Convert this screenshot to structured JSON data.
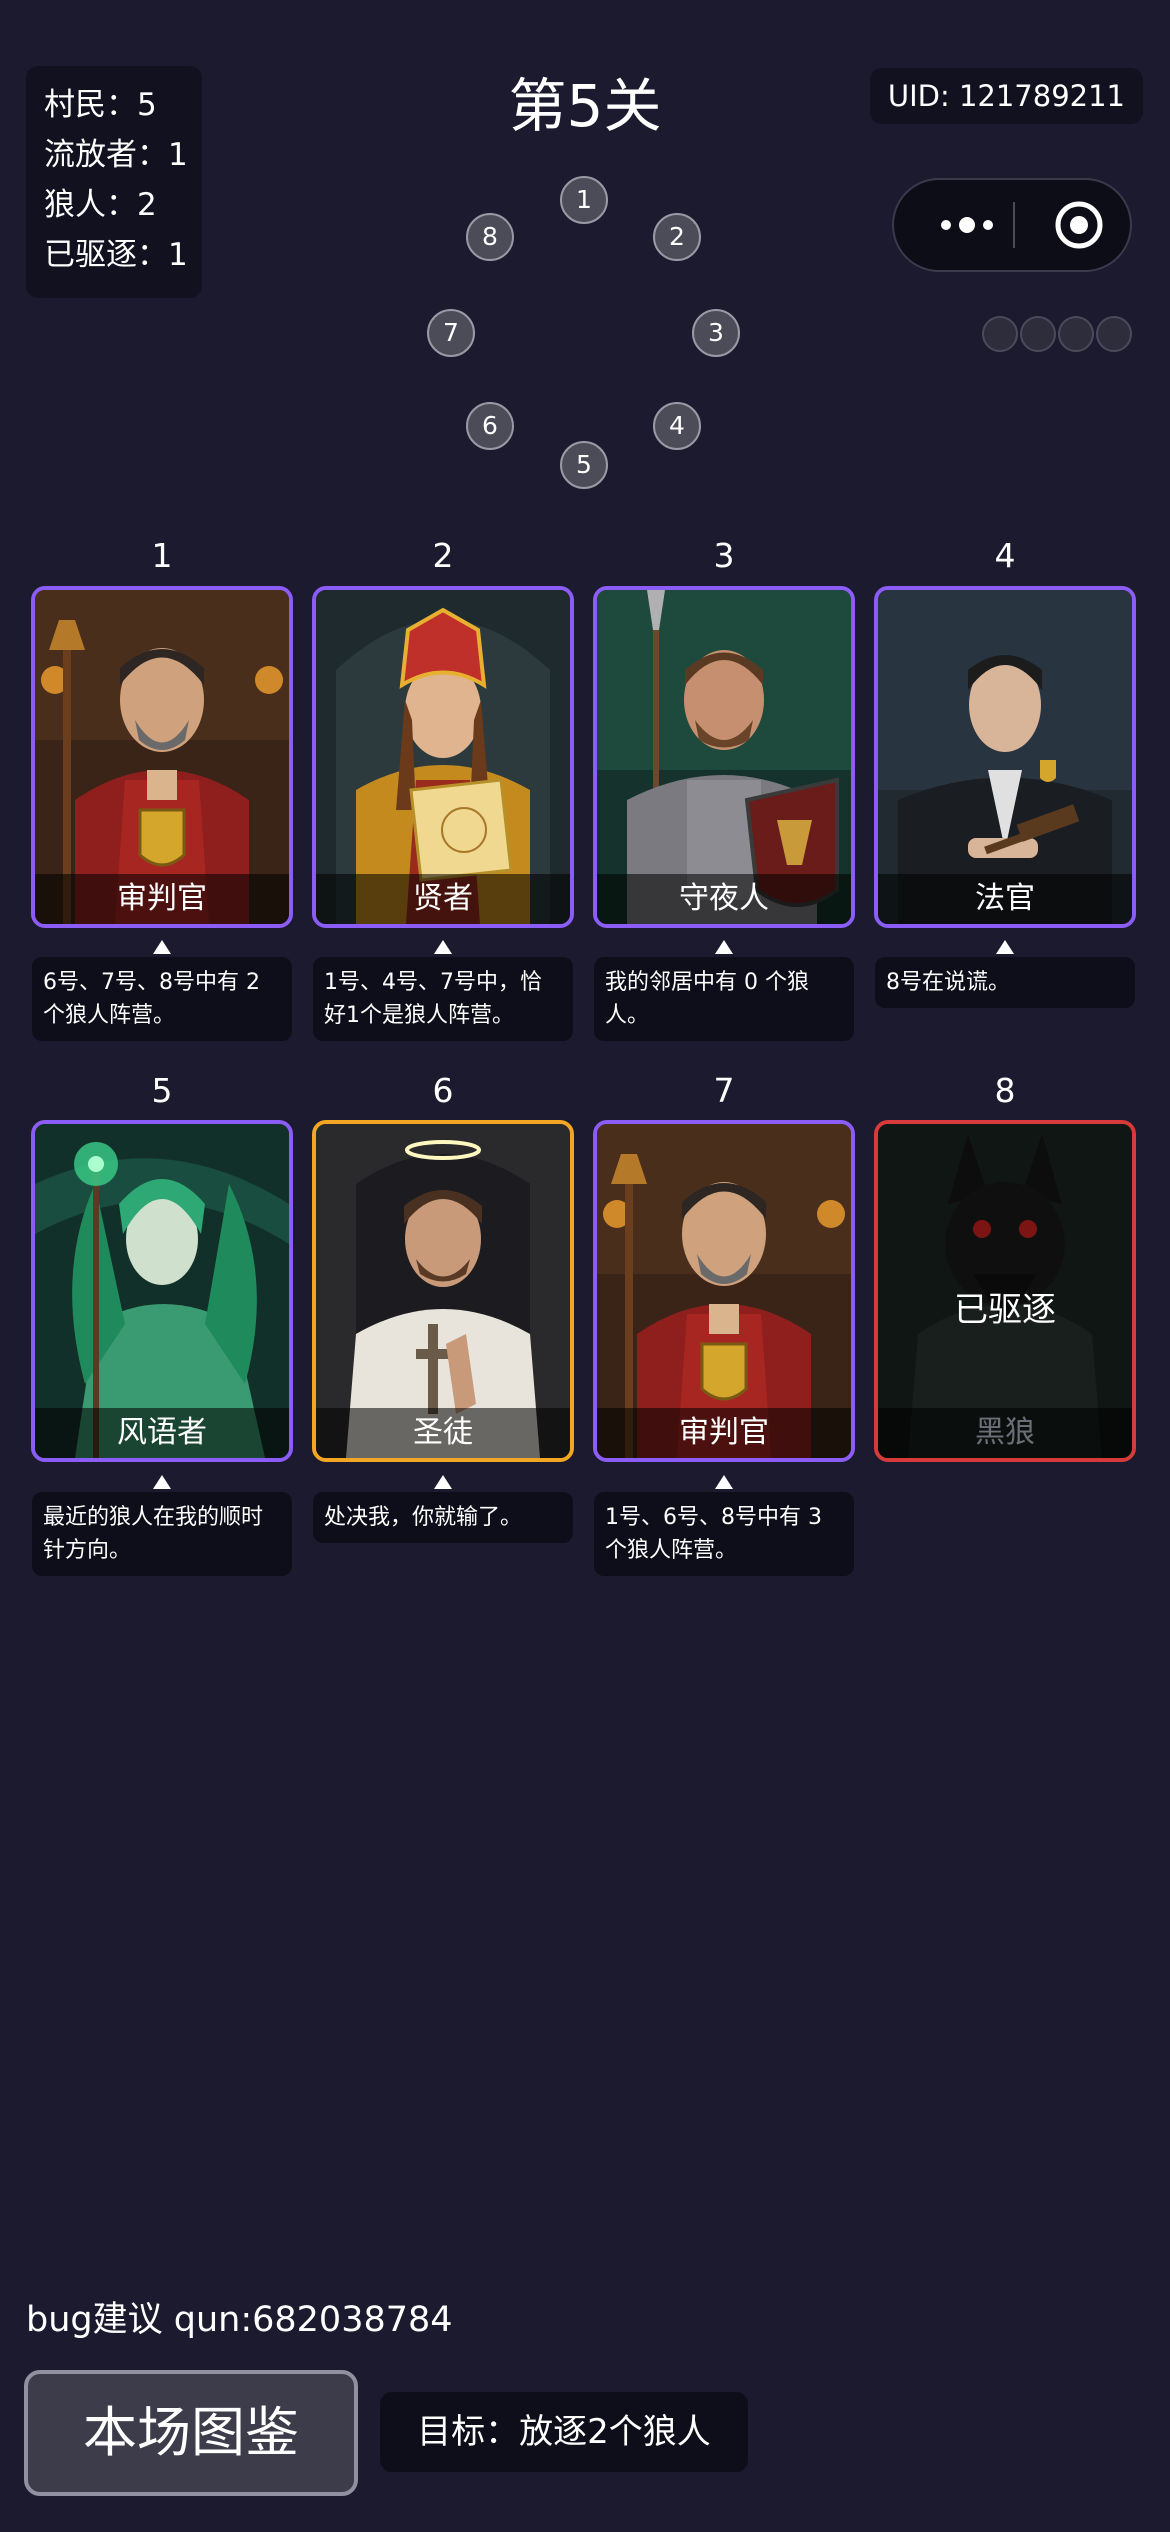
{
  "stats": {
    "villagers": "村民：5",
    "exiles": "流放者：1",
    "werewolves": "狼人：2",
    "expelled": "已驱逐：1"
  },
  "level_title": "第5关",
  "uid": "UID: 121789211",
  "seat_ring": [
    "1",
    "2",
    "3",
    "4",
    "5",
    "6",
    "7",
    "8"
  ],
  "players": [
    {
      "num": "1",
      "role": "审判官",
      "statement": "6号、7号、8号中有 2 个狼人阵营。",
      "border": "#8b5cf6",
      "icon": "judge-portrait"
    },
    {
      "num": "2",
      "role": "贤者",
      "statement": "1号、4号、7号中，恰好1个是狼人阵营。",
      "border": "#8b5cf6",
      "icon": "sage-portrait"
    },
    {
      "num": "3",
      "role": "守夜人",
      "statement": "我的邻居中有 0 个狼人。",
      "border": "#8b5cf6",
      "icon": "nightwatch-portrait"
    },
    {
      "num": "4",
      "role": "法官",
      "statement": "8号在说谎。",
      "border": "#8b5cf6",
      "icon": "magistrate-portrait"
    },
    {
      "num": "5",
      "role": "风语者",
      "statement": "最近的狼人在我的顺时针方向。",
      "border": "#8b5cf6",
      "icon": "windspeaker-portrait"
    },
    {
      "num": "6",
      "role": "圣徒",
      "statement": "处决我，你就输了。",
      "border": "#f2a623",
      "icon": "saint-portrait"
    },
    {
      "num": "7",
      "role": "审判官",
      "statement": "1号、6号、8号中有 3 个狼人阵营。",
      "border": "#8b5cf6",
      "icon": "judge-portrait"
    },
    {
      "num": "8",
      "role": "黑狼",
      "status": "已驱逐",
      "border": "#d73a3a",
      "icon": "black-wolf-portrait"
    }
  ],
  "footer": {
    "bug_text": "bug建议 qun:682038784",
    "codex_button": "本场图鉴",
    "goal_text": "目标：放逐2个狼人"
  }
}
